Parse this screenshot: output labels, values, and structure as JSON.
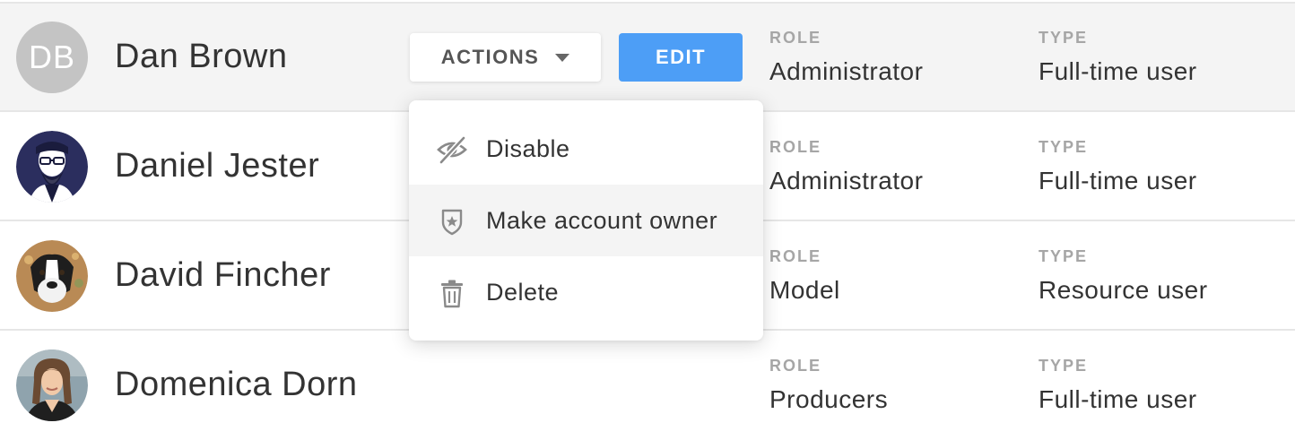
{
  "users": [
    {
      "name": "Dan Brown",
      "initials": "DB",
      "role_label": "ROLE",
      "role": "Administrator",
      "type_label": "TYPE",
      "type": "Full-time user"
    },
    {
      "name": "Daniel Jester",
      "role_label": "ROLE",
      "role": "Administrator",
      "type_label": "TYPE",
      "type": "Full-time user"
    },
    {
      "name": "David Fincher",
      "role_label": "ROLE",
      "role": "Model",
      "type_label": "TYPE",
      "type": "Resource user"
    },
    {
      "name": "Domenica Dorn",
      "role_label": "ROLE",
      "role": "Producers",
      "type_label": "TYPE",
      "type": "Full-time user"
    }
  ],
  "row_actions": {
    "actions_label": "ACTIONS",
    "edit_label": "EDIT"
  },
  "actions_menu": {
    "items": [
      {
        "label": "Disable",
        "icon": "eye-slash-icon"
      },
      {
        "label": "Make account owner",
        "icon": "shield-star-icon"
      },
      {
        "label": "Delete",
        "icon": "trash-icon"
      }
    ]
  },
  "colors": {
    "edit_button": "#4d9ef6",
    "selected_row": "#f4f4f4",
    "label_gray": "#a6a6a6",
    "initials_avatar": "#c4c4c4"
  }
}
